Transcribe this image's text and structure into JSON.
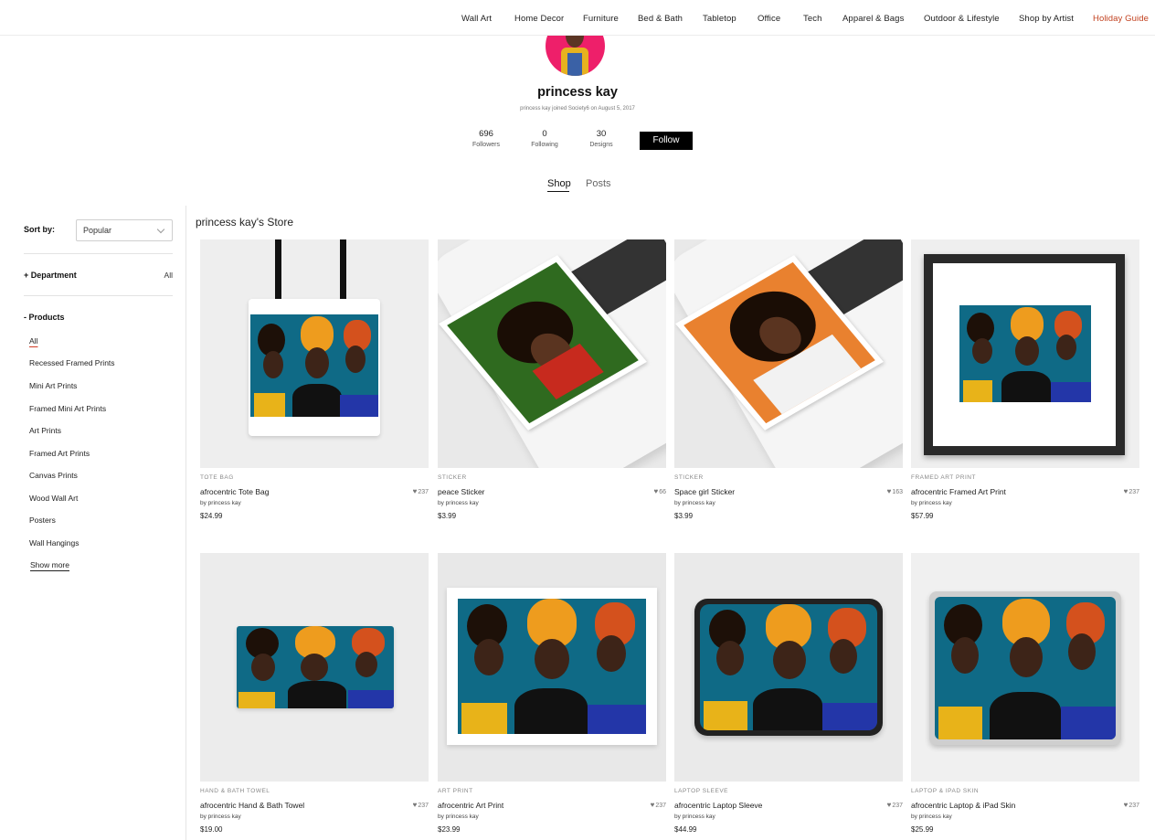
{
  "nav": {
    "items": [
      "Wall Art",
      "Home Decor",
      "Furniture",
      "Bed & Bath",
      "Tabletop",
      "Office",
      "Tech",
      "Apparel & Bags",
      "Outdoor & Lifestyle",
      "Shop by Artist"
    ],
    "highlight": "Holiday Guide",
    "highlight_color": "#c2411f"
  },
  "profile": {
    "name": "princess kay",
    "joined": "princess kay joined Society6 on August 5, 2017",
    "stats": [
      {
        "value": "696",
        "label": "Followers"
      },
      {
        "value": "0",
        "label": "Following"
      },
      {
        "value": "30",
        "label": "Designs"
      }
    ],
    "follow_label": "Follow",
    "avatar_bg": "#ee1f6a"
  },
  "tabs": [
    "Shop",
    "Posts"
  ],
  "sidebar": {
    "sort_label": "Sort by:",
    "sort_value": "Popular",
    "department_label": "+ Department",
    "department_value": "All",
    "products_label": "- Products",
    "products": [
      "All",
      "Recessed Framed Prints",
      "Mini Art Prints",
      "Framed Mini Art Prints",
      "Art Prints",
      "Framed Art Prints",
      "Canvas Prints",
      "Wood Wall Art",
      "Posters",
      "Wall Hangings"
    ],
    "show_more": "Show more"
  },
  "store": {
    "title": "princess kay's Store",
    "cards": [
      {
        "type": "TOTE BAG",
        "title": "afrocentric Tote Bag",
        "by": "by princess kay",
        "price": "$24.99",
        "likes": "237",
        "icon": "tote-bag-image"
      },
      {
        "type": "STICKER",
        "title": "peace Sticker",
        "by": "by princess kay",
        "price": "$3.99",
        "likes": "66",
        "icon": "sticker-image"
      },
      {
        "type": "STICKER",
        "title": "Space girl Sticker",
        "by": "by princess kay",
        "price": "$3.99",
        "likes": "163",
        "icon": "sticker-image"
      },
      {
        "type": "FRAMED ART PRINT",
        "title": "afrocentric Framed Art Print",
        "by": "by princess kay",
        "price": "$57.99",
        "likes": "237",
        "icon": "framed-print-image"
      },
      {
        "type": "HAND & BATH TOWEL",
        "title": "afrocentric Hand & Bath Towel",
        "by": "by princess kay",
        "price": "$19.00",
        "likes": "237",
        "icon": "towel-image"
      },
      {
        "type": "ART PRINT",
        "title": "afrocentric Art Print",
        "by": "by princess kay",
        "price": "$23.99",
        "likes": "237",
        "icon": "art-print-image"
      },
      {
        "type": "LAPTOP SLEEVE",
        "title": "afrocentric Laptop Sleeve",
        "by": "by princess kay",
        "price": "$44.99",
        "likes": "237",
        "icon": "laptop-sleeve-image"
      },
      {
        "type": "LAPTOP & IPAD SKIN",
        "title": "afrocentric Laptop & iPad Skin",
        "by": "by princess kay",
        "price": "$25.99",
        "likes": "237",
        "icon": "laptop-skin-image"
      }
    ]
  }
}
